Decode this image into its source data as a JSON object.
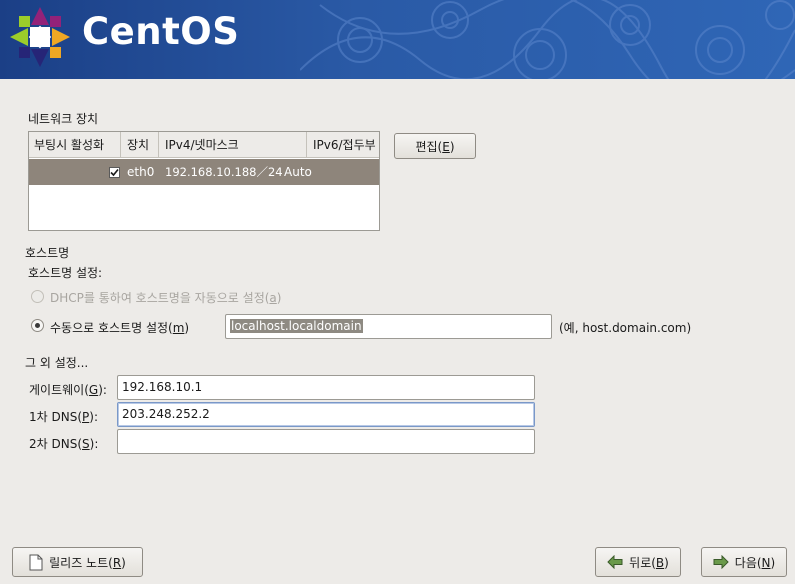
{
  "banner": {
    "brand": "CentOS"
  },
  "network_devices": {
    "title": "네트워크 장치",
    "columns": [
      "부팅시 활성화",
      "장치",
      "IPv4/넷마스크",
      "IPv6/접두부"
    ],
    "rows": [
      {
        "active_on_boot": true,
        "device": "eth0",
        "ipv4": "192.168.10.188／24",
        "ipv6": "Auto"
      }
    ],
    "edit_button": {
      "label_before": "편집(",
      "mnemonic": "E",
      "label_after": ")"
    }
  },
  "hostname": {
    "title": "호스트명",
    "setting_label": "호스트명 설정:",
    "dhcp_option": {
      "label_before": "DHCP를 통하여 호스트명을 자동으로 설정(",
      "mnemonic": "a",
      "label_after": ")",
      "selected": false,
      "enabled": false
    },
    "manual_option": {
      "label_before": "수동으로 호스트명 설정(",
      "mnemonic": "m",
      "label_after": ")",
      "selected": true
    },
    "manual_value": "localhost.localdomain",
    "example": "(예, host.domain.com)"
  },
  "other_settings": {
    "title": "그 외 설정...",
    "gateway": {
      "label_before": "게이트웨이(",
      "mnemonic": "G",
      "label_after": "):",
      "value": "192.168.10.1"
    },
    "dns1": {
      "label_before": "1차 DNS(",
      "mnemonic": "P",
      "label_after": "):",
      "value": "203.248.252.2"
    },
    "dns2": {
      "label_before": "2차 DNS(",
      "mnemonic": "S",
      "label_after": "):",
      "value": ""
    }
  },
  "footer": {
    "release_notes": {
      "label_before": "릴리즈 노트(",
      "mnemonic": "R",
      "label_after": ")"
    },
    "back": {
      "label_before": "뒤로(",
      "mnemonic": "B",
      "label_after": ")"
    },
    "next": {
      "label_before": "다음(",
      "mnemonic": "N",
      "label_after": ")"
    }
  }
}
